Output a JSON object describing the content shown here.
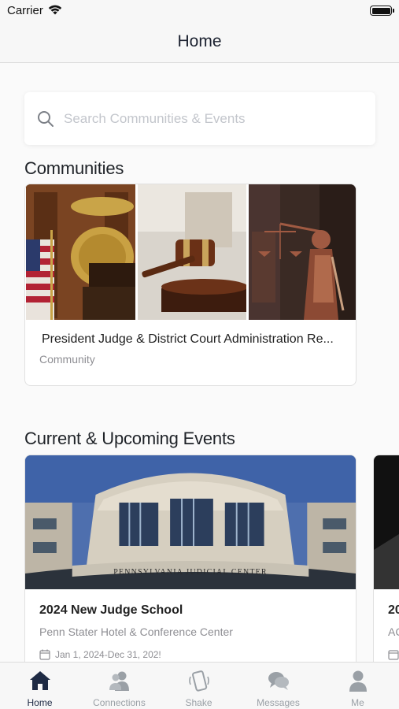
{
  "status_bar": {
    "carrier": "Carrier"
  },
  "nav": {
    "title": "Home"
  },
  "search": {
    "placeholder": "Search Communities & Events",
    "value": ""
  },
  "communities": {
    "section_title": "Communities",
    "cards": [
      {
        "title": "President Judge & District Court Administration Re...",
        "subtitle": "Community"
      }
    ]
  },
  "events": {
    "section_title": "Current & Upcoming Events",
    "cards": [
      {
        "title": "2024 New Judge School",
        "location": "Penn Stater Hotel & Conference Center",
        "date": "Jan 1, 2024-Dec 31, 202!",
        "building_sign": "PENNSYLVANIA JUDICIAL CENTER"
      },
      {
        "title": "20",
        "location": "AC",
        "date": ""
      }
    ]
  },
  "tab_bar": {
    "active": "Home",
    "items": [
      {
        "label": "Home",
        "icon": "home-icon"
      },
      {
        "label": "Connections",
        "icon": "connections-icon"
      },
      {
        "label": "Shake",
        "icon": "shake-icon"
      },
      {
        "label": "Messages",
        "icon": "messages-icon"
      },
      {
        "label": "Me",
        "icon": "person-icon"
      }
    ]
  },
  "colors": {
    "active_tab": "#1e2a44",
    "inactive_tab": "#9aa0a6",
    "muted_text": "#8e8e93",
    "placeholder": "#c3c6cc"
  }
}
